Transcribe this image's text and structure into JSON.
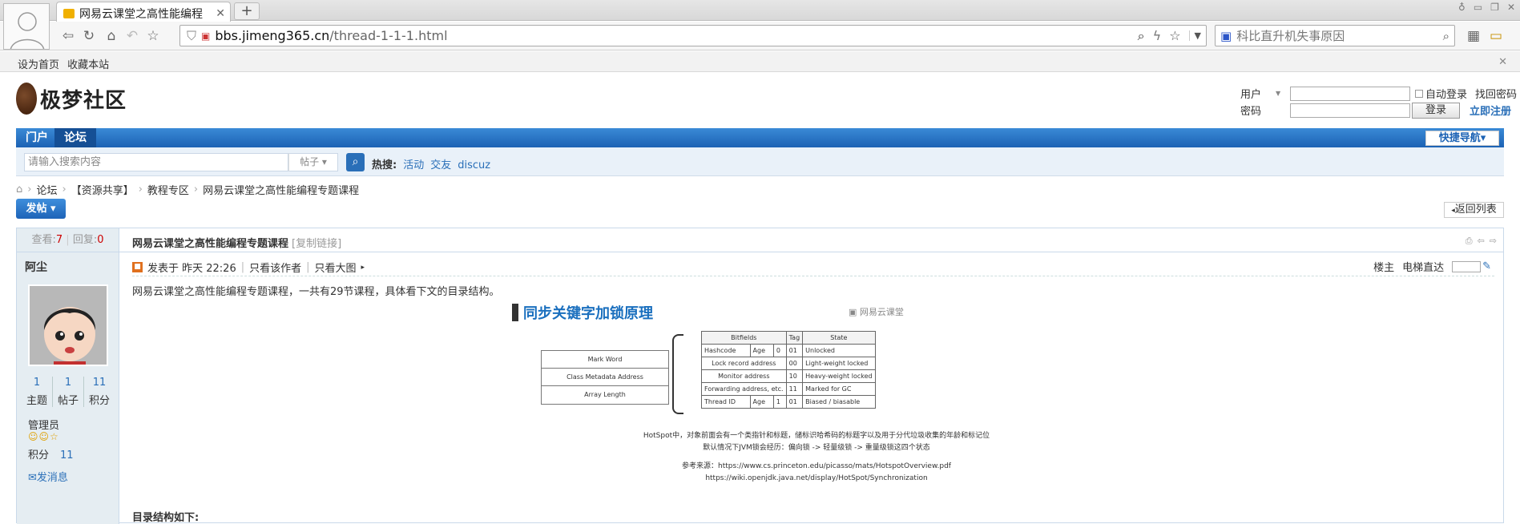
{
  "browser": {
    "tab_title": "网易云课堂之高性能编程",
    "url_host": "bbs.jimeng365.cn",
    "url_path": "/thread-1-1-1.html",
    "search_text": "科比直升机失事原因",
    "bookmarks": [
      "设为首页",
      "收藏本站"
    ]
  },
  "site": {
    "logo_text": "极梦社区",
    "login": {
      "user_label": "用户",
      "password_label": "密码",
      "auto_login": "自动登录",
      "find_password": "找回密码",
      "login_button": "登录",
      "register": "立即注册"
    },
    "nav": [
      "门户",
      "论坛"
    ],
    "quick_nav": "快捷导航",
    "search": {
      "placeholder": "请输入搜索内容",
      "type": "帖子",
      "hot_label": "热搜:",
      "hot_items": [
        "活动",
        "交友",
        "discuz"
      ]
    },
    "breadcrumb": [
      "论坛",
      "【资源共享】",
      "教程专区",
      "网易云课堂之高性能编程专题课程"
    ],
    "post_button": "发帖",
    "back_button": "返回列表"
  },
  "thread": {
    "views_label": "查看:",
    "views": "7",
    "replies_label": "回复:",
    "replies": "0",
    "title": "网易云课堂之高性能编程专题课程",
    "copy_link": "[复制链接]",
    "author": "阿尘",
    "counts": [
      {
        "n": "1",
        "label": "主题"
      },
      {
        "n": "1",
        "label": "帖子"
      },
      {
        "n": "11",
        "label": "积分"
      }
    ],
    "role": "管理员",
    "points_label": "积分",
    "points": "11",
    "message": "发消息",
    "posted": "发表于 昨天 22:26",
    "only_author": "只看该作者",
    "only_image": "只看大图",
    "floor": "楼主",
    "elevator": "电梯直达",
    "body": "网易云课堂之高性能编程专题课程，一共有29节课程，具体看下文的目录结构。",
    "toc": "目录结构如下:"
  },
  "figure": {
    "title": "同步关键字加锁原理",
    "brand": "网易云课堂",
    "boxes": [
      "Mark Word",
      "Class Metadata Address",
      "Array Length"
    ],
    "table_header": [
      "Bitfields",
      "Tag",
      "State"
    ],
    "rows": [
      [
        "Hashcode",
        "Age",
        "0",
        "01",
        "Unlocked"
      ],
      [
        "Lock record address",
        "",
        "",
        "00",
        "Light-weight locked"
      ],
      [
        "Monitor address",
        "",
        "",
        "10",
        "Heavy-weight locked"
      ],
      [
        "Forwarding address, etc.",
        "",
        "",
        "11",
        "Marked for GC"
      ],
      [
        "Thread ID",
        "Age",
        "1",
        "01",
        "Biased / biasable"
      ]
    ],
    "note1": "HotSpot中，对象前面会有一个类指针和标题，储标识哈希码的标题字以及用于分代垃圾收集的年龄和标记位",
    "note2": "默认情况下JVM锁会经历：偏向锁 -> 轻量级锁 -> 重量级锁这四个状态",
    "ref1": "参考来源：https://www.cs.princeton.edu/picasso/mats/HotspotOverview.pdf",
    "ref2": "https://wiki.openjdk.java.net/display/HotSpot/Synchronization"
  }
}
